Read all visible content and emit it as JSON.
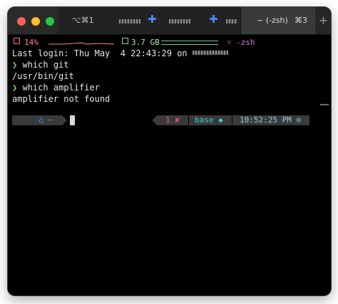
{
  "tabs": [
    {
      "shortcut": "⌥⌘1"
    },
    {
      "title": "~ (-zsh)",
      "shortcut": "⌘3"
    }
  ],
  "tab_plus": "+",
  "status": {
    "cpu": "14%",
    "memory": "3.7 GB",
    "branch_icon": "⑂",
    "shell": "-zsh"
  },
  "terminal_lines": [
    "Last login: Thu May  4 22:43:29 on",
    "which git",
    "/usr/bin/git",
    "which amplifier",
    "amplifier not found"
  ],
  "prompt_symbol": "❯",
  "prompt": {
    "apple": "",
    "home": "⌂ ~",
    "error_code": "1 ✘",
    "env": "base ◆",
    "time": "10:52:25 PM ⊙"
  },
  "colors": {
    "cpu": "#ff8a8a",
    "memory": "#a9e8a9",
    "git": "#e07ad6",
    "prompt_arrow": "#6edc6e",
    "home": "#3aa0ff",
    "error": "#e06060",
    "env": "#3fc7d6"
  }
}
